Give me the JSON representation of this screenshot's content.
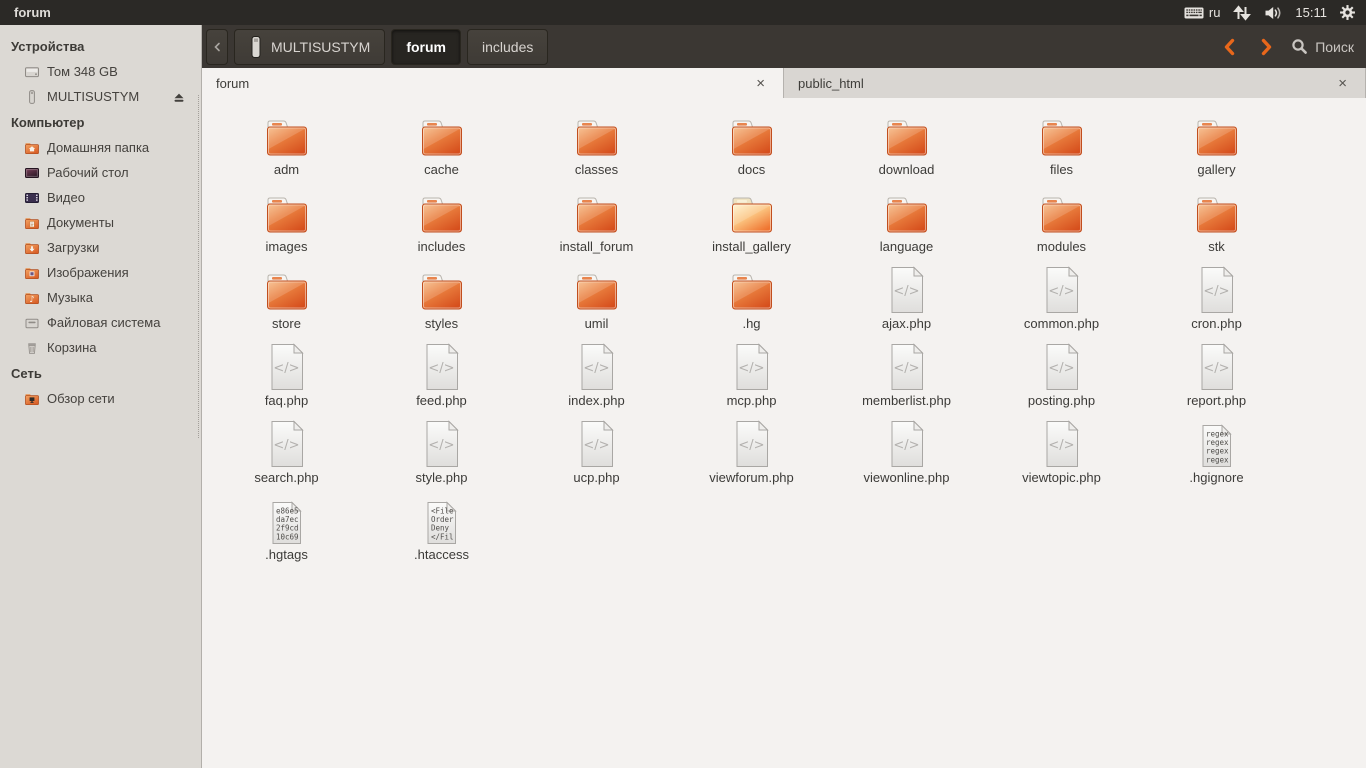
{
  "window": {
    "title": "forum"
  },
  "tray": {
    "keyboard_layout": "ru",
    "time": "15:11"
  },
  "toolbar": {
    "breadcrumbs": [
      {
        "label": "MULTISUSTYM",
        "icon": "usb-drive",
        "active": false
      },
      {
        "label": "forum",
        "icon": "",
        "active": true
      },
      {
        "label": "includes",
        "icon": "",
        "active": false
      }
    ],
    "search_label": "Поиск"
  },
  "tabs": [
    {
      "label": "forum",
      "active": true
    },
    {
      "label": "public_html",
      "active": false
    }
  ],
  "glyphs": {
    "close": "×",
    "code": "</>"
  },
  "sidebar": {
    "sections": [
      {
        "heading": "Устройства",
        "items": [
          {
            "label": "Том 348 GB",
            "icon": "harddisk",
            "eject": false
          },
          {
            "label": "MULTISUSTYM",
            "icon": "usb-drive",
            "eject": true
          }
        ]
      },
      {
        "heading": "Компьютер",
        "items": [
          {
            "label": "Домашняя папка",
            "icon": "home-folder",
            "eject": false
          },
          {
            "label": "Рабочий стол",
            "icon": "desktop",
            "eject": false
          },
          {
            "label": "Видео",
            "icon": "videos",
            "eject": false
          },
          {
            "label": "Документы",
            "icon": "documents",
            "eject": false
          },
          {
            "label": "Загрузки",
            "icon": "downloads",
            "eject": false
          },
          {
            "label": "Изображения",
            "icon": "pictures",
            "eject": false
          },
          {
            "label": "Музыка",
            "icon": "music",
            "eject": false
          },
          {
            "label": "Файловая система",
            "icon": "filesystem",
            "eject": false
          },
          {
            "label": "Корзина",
            "icon": "trash",
            "eject": false
          }
        ]
      },
      {
        "heading": "Сеть",
        "items": [
          {
            "label": "Обзор сети",
            "icon": "network",
            "eject": false
          }
        ]
      }
    ]
  },
  "files": [
    {
      "name": "adm",
      "type": "folder"
    },
    {
      "name": "cache",
      "type": "folder"
    },
    {
      "name": "classes",
      "type": "folder"
    },
    {
      "name": "docs",
      "type": "folder"
    },
    {
      "name": "download",
      "type": "folder"
    },
    {
      "name": "files",
      "type": "folder"
    },
    {
      "name": "gallery",
      "type": "folder"
    },
    {
      "name": "images",
      "type": "folder"
    },
    {
      "name": "includes",
      "type": "folder"
    },
    {
      "name": "install_forum",
      "type": "folder"
    },
    {
      "name": "install_gallery",
      "type": "folder-open"
    },
    {
      "name": "language",
      "type": "folder"
    },
    {
      "name": "modules",
      "type": "folder"
    },
    {
      "name": "stk",
      "type": "folder"
    },
    {
      "name": "store",
      "type": "folder"
    },
    {
      "name": "styles",
      "type": "folder"
    },
    {
      "name": "umil",
      "type": "folder"
    },
    {
      "name": ".hg",
      "type": "folder"
    },
    {
      "name": "ajax.php",
      "type": "code"
    },
    {
      "name": "common.php",
      "type": "code"
    },
    {
      "name": "cron.php",
      "type": "code"
    },
    {
      "name": "faq.php",
      "type": "code"
    },
    {
      "name": "feed.php",
      "type": "code"
    },
    {
      "name": "index.php",
      "type": "code"
    },
    {
      "name": "mcp.php",
      "type": "code"
    },
    {
      "name": "memberlist.php",
      "type": "code"
    },
    {
      "name": "posting.php",
      "type": "code"
    },
    {
      "name": "report.php",
      "type": "code"
    },
    {
      "name": "search.php",
      "type": "code"
    },
    {
      "name": "style.php",
      "type": "code"
    },
    {
      "name": "ucp.php",
      "type": "code"
    },
    {
      "name": "viewforum.php",
      "type": "code"
    },
    {
      "name": "viewonline.php",
      "type": "code"
    },
    {
      "name": "viewtopic.php",
      "type": "code"
    },
    {
      "name": ".hgignore",
      "type": "text",
      "preview": [
        "regex",
        "regex",
        "regex",
        "regex"
      ]
    },
    {
      "name": ".hgtags",
      "type": "text",
      "preview": [
        "e86e5",
        "da7ec",
        "2f9cd",
        "10c69"
      ]
    },
    {
      "name": ".htaccess",
      "type": "text",
      "preview": [
        "<File",
        "Order",
        "Deny",
        "</Fil"
      ]
    }
  ]
}
